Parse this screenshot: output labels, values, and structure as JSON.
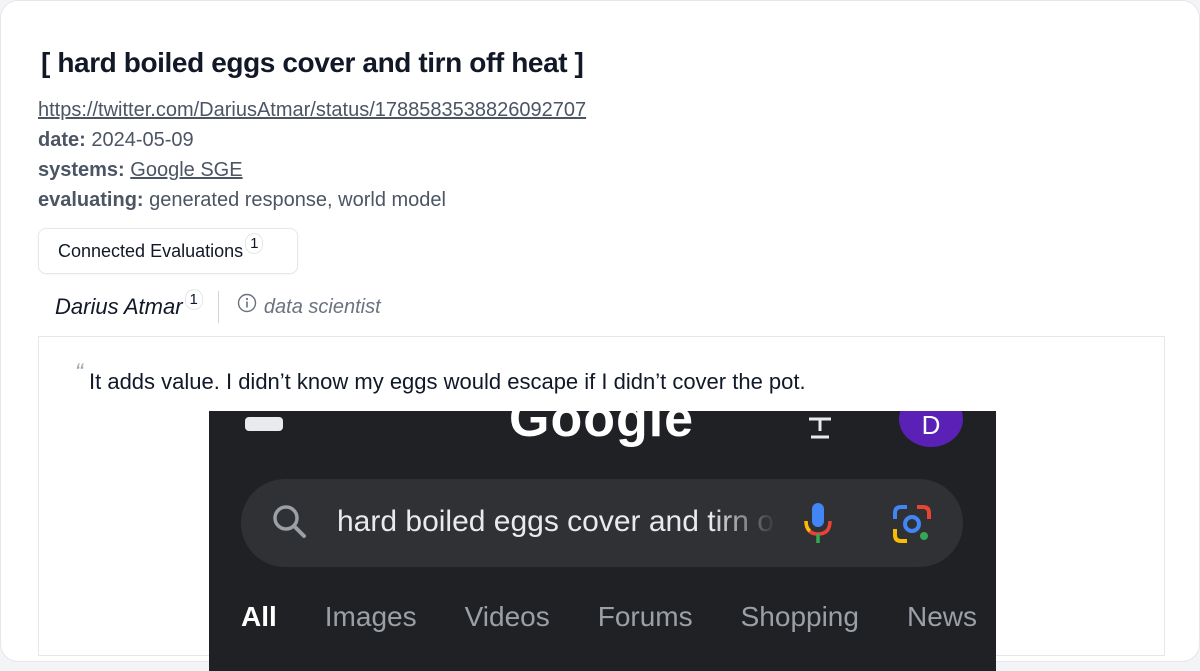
{
  "title": "hard boiled eggs cover and tirn off heat",
  "link": "https://twitter.com/DariusAtmar/status/1788583538826092707",
  "meta": {
    "date_label": "date:",
    "date_value": "2024-05-09",
    "systems_label": "systems:",
    "systems_value": "Google SGE",
    "evaluating_label": "evaluating:",
    "evaluating_value": "generated response, world model"
  },
  "connected": {
    "label": "Connected Evaluations",
    "count": "1"
  },
  "author": {
    "name": "Darius Atmar",
    "count": "1",
    "role": "data scientist",
    "icon": "info-icon"
  },
  "quote": {
    "text": "It adds value. I didn’t know my eggs would escape if I didn’t cover the pot."
  },
  "screenshot": {
    "logo": "Google",
    "avatar_letter": "D",
    "search_text": "hard boiled eggs cover and tirn off heat",
    "tabs": [
      "All",
      "Images",
      "Videos",
      "Forums",
      "Shopping",
      "News"
    ],
    "active_tab": "All"
  },
  "colors": {
    "text": "#111827",
    "muted": "#4b5563",
    "dark_bg": "#202124",
    "search_bg": "#303134",
    "avatar": "#5b21b6"
  }
}
